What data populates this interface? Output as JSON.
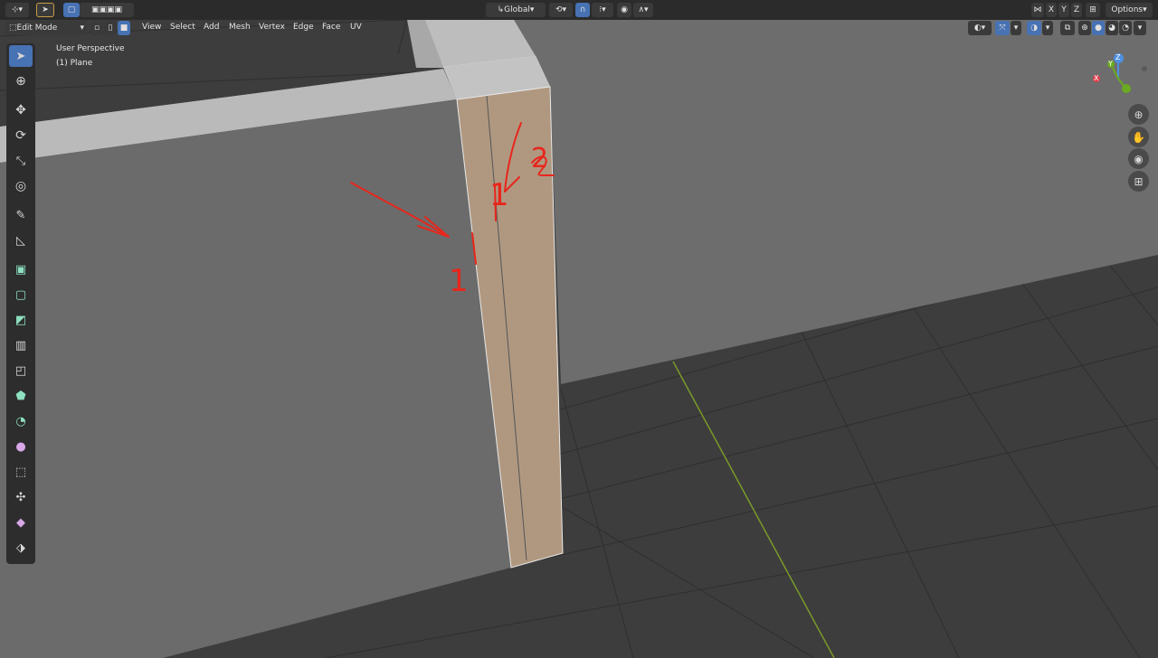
{
  "topbar": {
    "transform_orientation": "Global",
    "axes": [
      "X",
      "Y",
      "Z"
    ],
    "options_label": "Options"
  },
  "header": {
    "mode": "Edit Mode",
    "menus": [
      "View",
      "Select",
      "Add",
      "Mesh",
      "Vertex",
      "Edge",
      "Face",
      "UV"
    ]
  },
  "overlay": {
    "view_name": "User Perspective",
    "object_name": "(1) Plane"
  },
  "gizmo": {
    "x": "X",
    "y": "Y",
    "z": "Z"
  },
  "annotations": {
    "one_a": "1",
    "one_b": "1",
    "two": "2"
  },
  "colors": {
    "selected_face": "#b09880",
    "annotation": "#e8261c",
    "ui_accent": "#4772b3",
    "y_axis_line": "#7a9a2a"
  },
  "toolbar": {
    "tools": [
      "select-box",
      "cursor",
      "move",
      "rotate",
      "scale",
      "transform",
      "annotate",
      "measure",
      "extrude-region",
      "inset-faces",
      "bevel",
      "loop-cut",
      "offset-edge-loop",
      "knife",
      "poly-build",
      "spin",
      "smooth",
      "shrink-fatten",
      "push-pull",
      "shear",
      "rip-region"
    ]
  }
}
